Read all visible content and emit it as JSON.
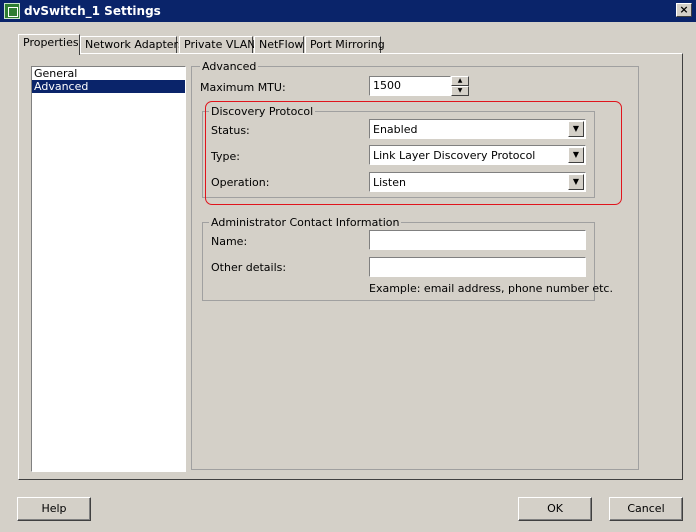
{
  "window": {
    "title": "dvSwitch_1 Settings",
    "close_glyph": "×",
    "icon": "dvswitch-icon"
  },
  "tabs": [
    {
      "label": "Properties",
      "active": true
    },
    {
      "label": "Network Adapters",
      "active": false
    },
    {
      "label": "Private VLAN",
      "active": false
    },
    {
      "label": "NetFlow",
      "active": false
    },
    {
      "label": "Port Mirroring",
      "active": false
    }
  ],
  "sidebar": {
    "items": [
      {
        "label": "General",
        "selected": false
      },
      {
        "label": "Advanced",
        "selected": true
      }
    ]
  },
  "advanced": {
    "legend": "Advanced",
    "max_mtu": {
      "label": "Maximum MTU:",
      "value": "1500"
    },
    "discovery": {
      "legend": "Discovery Protocol",
      "status": {
        "label": "Status:",
        "value": "Enabled"
      },
      "type": {
        "label": "Type:",
        "value": "Link Layer Discovery Protocol"
      },
      "operation": {
        "label": "Operation:",
        "value": "Listen"
      }
    },
    "admin": {
      "legend": "Administrator Contact Information",
      "name": {
        "label": "Name:",
        "value": ""
      },
      "other": {
        "label": "Other details:",
        "value": ""
      },
      "example": "Example: email address, phone number etc."
    }
  },
  "footer": {
    "help": "Help",
    "ok": "OK",
    "cancel": "Cancel"
  },
  "colors": {
    "titlebar": "#0a246a",
    "highlight": "#e0141c",
    "face": "#d4d0c8"
  }
}
